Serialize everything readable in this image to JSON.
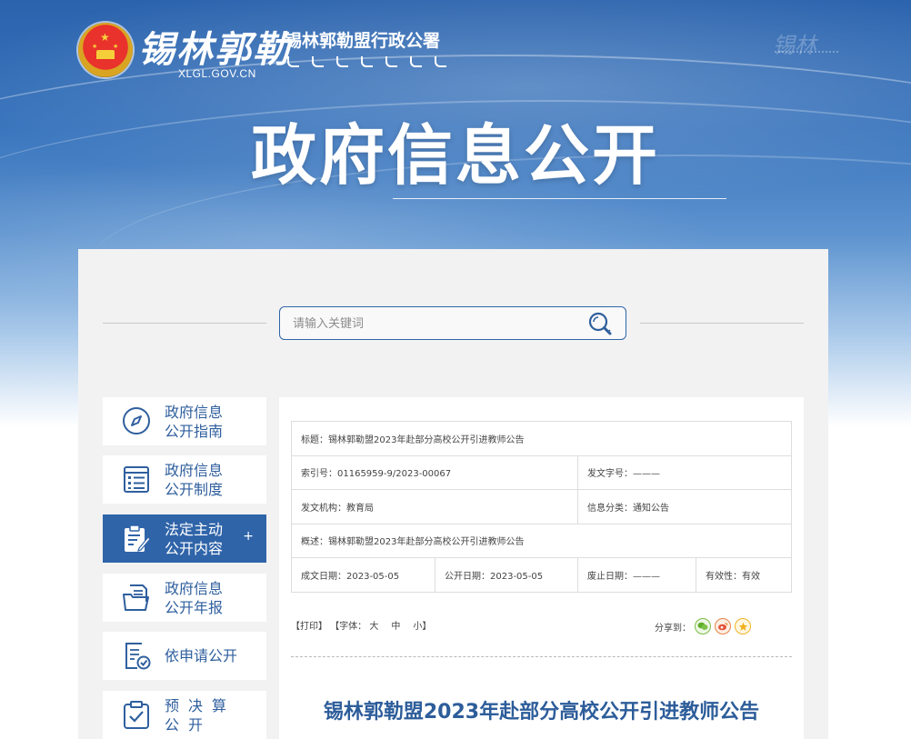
{
  "header": {
    "logo_script": "锡林郭勒",
    "logo_domain": "XLGL.GOV.CN",
    "org_name": "锡林郭勒盟行政公署",
    "page_title": "政府信息公开"
  },
  "search": {
    "placeholder": "请输入关键词"
  },
  "sidebar": {
    "items": [
      {
        "label": "政府信息\n公开指南",
        "icon": "compass-icon",
        "active": false
      },
      {
        "label": "政府信息\n公开制度",
        "icon": "list-document-icon",
        "active": false
      },
      {
        "label": "法定主动\n公开内容",
        "icon": "clipboard-edit-icon",
        "active": true,
        "expand": "+"
      },
      {
        "label": "政府信息\n公开年报",
        "icon": "folder-document-icon",
        "active": false
      },
      {
        "label": "依申请公开",
        "icon": "document-check-icon",
        "active": false
      },
      {
        "label": "预决算\n公开",
        "icon": "clipboard-check-icon",
        "active": false
      }
    ]
  },
  "meta": {
    "title_label": "标题：",
    "title_value": "锡林郭勒盟2023年赴部分高校公开引进教师公告",
    "index_label": "索引号：",
    "index_value": "01165959-9/2023-00067",
    "doc_no_label": "发文字号：",
    "doc_no_value": "———",
    "issuer_label": "发文机构：",
    "issuer_value": "教育局",
    "category_label": "信息分类：",
    "category_value": "通知公告",
    "summary_label": "概述：",
    "summary_value": "锡林郭勒盟2023年赴部分高校公开引进教师公告",
    "created_label": "成文日期：",
    "created_value": "2023-05-05",
    "published_label": "公开日期：",
    "published_value": "2023-05-05",
    "expiry_label": "废止日期：",
    "expiry_value": "———",
    "validity_label": "有效性：",
    "validity_value": "有效"
  },
  "toolbar": {
    "print_label": "【打印】",
    "font_label": "【字体：",
    "font_large": "大",
    "font_medium": "中",
    "font_small": "小】",
    "share_label": "分享到："
  },
  "article": {
    "title": "锡林郭勒盟2023年赴部分高校公开引进教师公告"
  },
  "colors": {
    "primary": "#2f64a9",
    "panel_bg": "#f2f2f2",
    "link_blue": "#2f5f9e"
  }
}
